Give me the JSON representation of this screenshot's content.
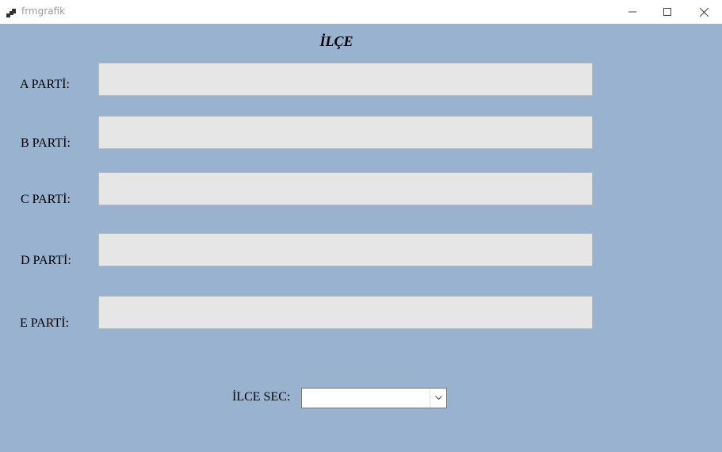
{
  "window": {
    "title": "frmgrafik",
    "icon": "app-window-icon",
    "controls": [
      "minimize-icon",
      "maximize-icon",
      "close-icon"
    ]
  },
  "form": {
    "heading": "İLÇE",
    "background_color": "#98b2d0",
    "parties": [
      {
        "label": "A PARTİ:",
        "value": ""
      },
      {
        "label": "B PARTİ:",
        "value": ""
      },
      {
        "label": "C PARTİ:",
        "value": ""
      },
      {
        "label": "D PARTİ:",
        "value": ""
      },
      {
        "label": "E PARTİ:",
        "value": ""
      }
    ],
    "district_select": {
      "label": "İLCE SEC:",
      "selected": ""
    }
  }
}
